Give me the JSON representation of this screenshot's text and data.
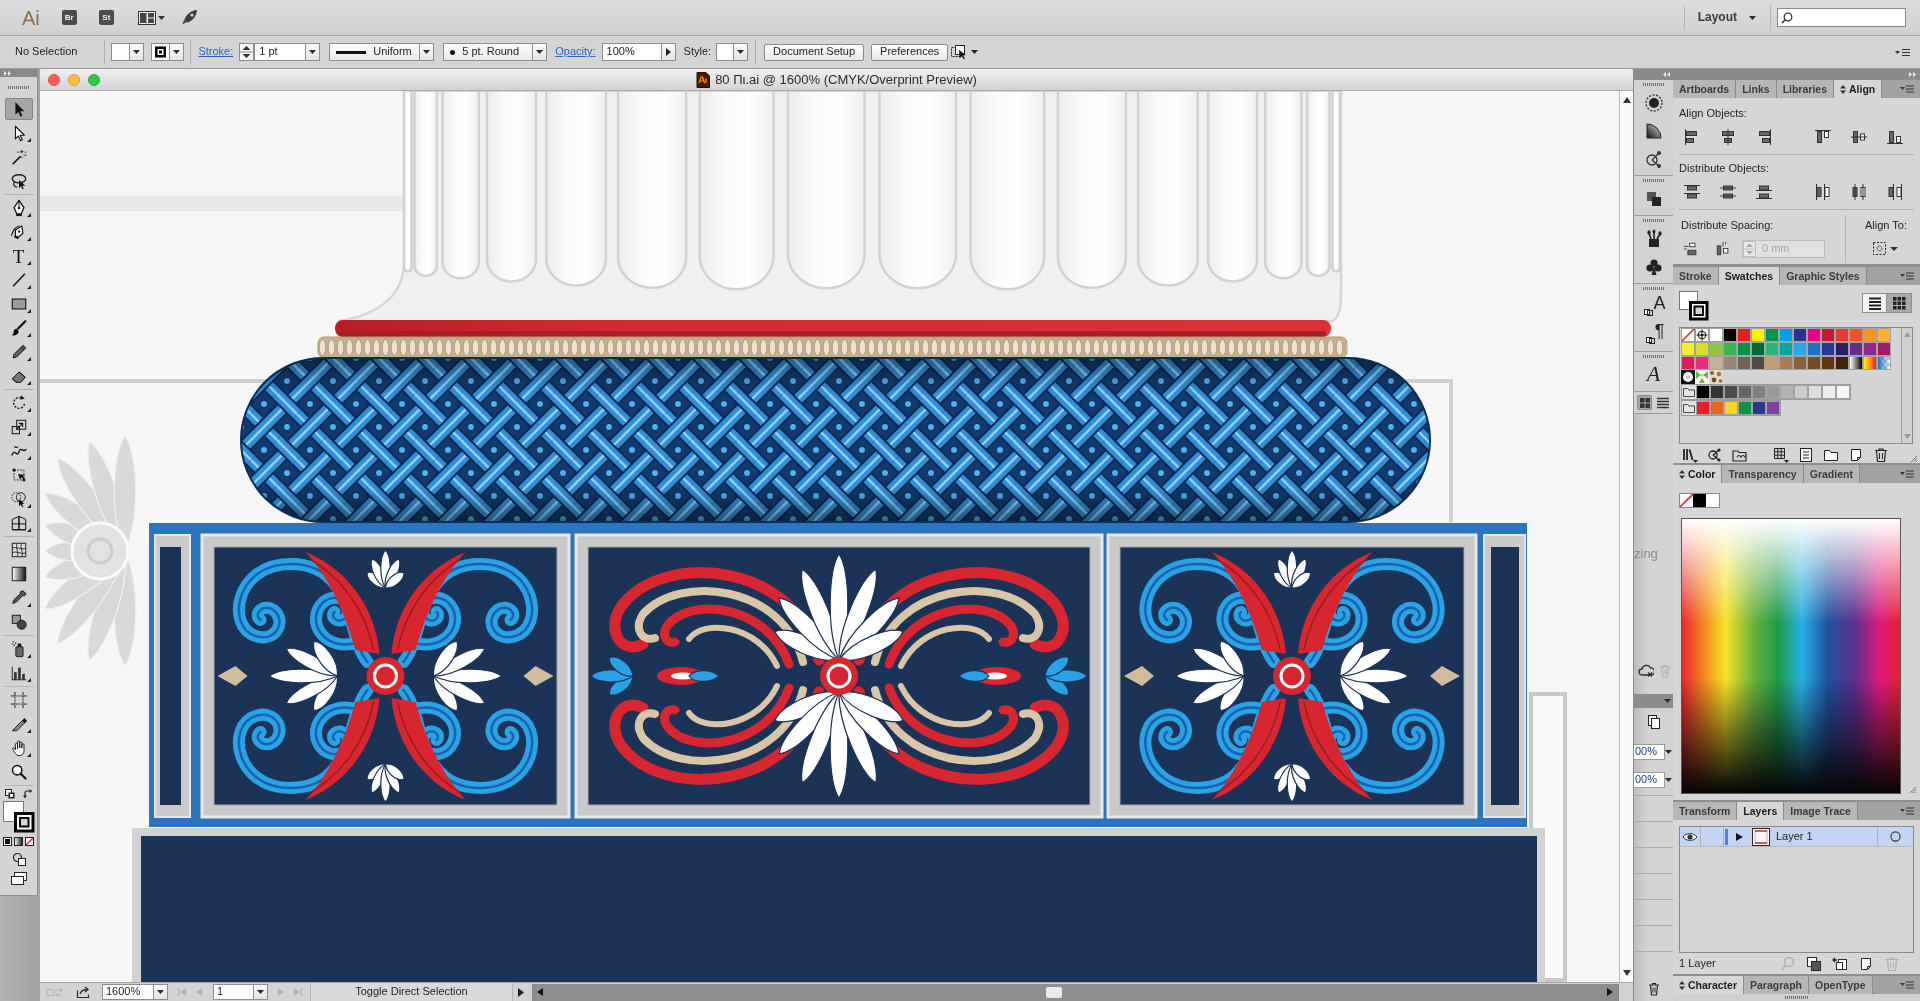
{
  "app_bar": {
    "logo": "Ai",
    "bridge": "Br",
    "stock": "St",
    "workspace": "Layout"
  },
  "control_bar": {
    "selection": "No Selection",
    "stroke_label": "Stroke:",
    "stroke_weight": "1 pt",
    "profile": "Uniform",
    "brush": "5 pt. Round",
    "opacity_label": "Opacity:",
    "opacity": "100%",
    "style_label": "Style:",
    "buttons": [
      "Document Setup",
      "Preferences"
    ]
  },
  "tool_groups": [
    [
      {
        "kind": "selection",
        "selected": true,
        "flyout": false
      },
      {
        "kind": "direct-selection",
        "selected": false,
        "flyout": true
      },
      {
        "kind": "magic-wand",
        "selected": false,
        "flyout": false
      },
      {
        "kind": "lasso",
        "selected": false,
        "flyout": false
      }
    ],
    [
      {
        "kind": "pen",
        "selected": false,
        "flyout": true
      },
      {
        "kind": "curvature",
        "selected": false,
        "flyout": true
      },
      {
        "kind": "type",
        "glyph": "T",
        "selected": false,
        "flyout": true
      },
      {
        "kind": "line",
        "selected": false,
        "flyout": true
      },
      {
        "kind": "rectangle",
        "selected": false,
        "flyout": true
      },
      {
        "kind": "paintbrush",
        "selected": false,
        "flyout": true
      },
      {
        "kind": "pencil",
        "selected": false,
        "flyout": true
      },
      {
        "kind": "eraser",
        "selected": false,
        "flyout": true
      }
    ],
    [
      {
        "kind": "rotate",
        "selected": false,
        "flyout": true
      },
      {
        "kind": "scale",
        "selected": false,
        "flyout": true
      },
      {
        "kind": "width",
        "selected": false,
        "flyout": true
      },
      {
        "kind": "free-transform",
        "selected": false,
        "flyout": false
      },
      {
        "kind": "shape-builder",
        "selected": false,
        "flyout": true
      },
      {
        "kind": "perspective",
        "selected": false,
        "flyout": true
      }
    ],
    [
      {
        "kind": "mesh",
        "selected": false,
        "flyout": false
      },
      {
        "kind": "gradient",
        "selected": false,
        "flyout": false
      },
      {
        "kind": "eyedropper",
        "selected": false,
        "flyout": true
      },
      {
        "kind": "blend",
        "selected": false,
        "flyout": false
      }
    ],
    [
      {
        "kind": "symbol-sprayer",
        "selected": false,
        "flyout": true
      },
      {
        "kind": "graph",
        "selected": false,
        "flyout": true
      }
    ],
    [
      {
        "kind": "artboard",
        "selected": false,
        "flyout": false
      },
      {
        "kind": "slice",
        "selected": false,
        "flyout": true
      },
      {
        "kind": "hand",
        "selected": false,
        "flyout": true
      },
      {
        "kind": "zoom",
        "selected": false,
        "flyout": false
      }
    ]
  ],
  "document": {
    "title": "80 Πι.ai @ 1600% (CMYK/Overprint Preview)"
  },
  "status_bar": {
    "buttons": [
      {
        "kind": "sync",
        "disabled": true
      },
      {
        "kind": "share",
        "disabled": false
      }
    ],
    "zoom": "1600%",
    "nav_before": [
      {
        "kind": "first",
        "disabled": true
      },
      {
        "kind": "previous",
        "disabled": true
      }
    ],
    "artboard": "1",
    "nav_after": [
      {
        "kind": "next",
        "disabled": true
      },
      {
        "kind": "last",
        "disabled": true
      }
    ],
    "message": "Toggle Direct Selection"
  },
  "dock": {
    "groups": [
      [
        {
          "kind": "appearance"
        },
        {
          "kind": "transparency"
        },
        {
          "kind": "links"
        }
      ],
      [
        {
          "kind": "pathfinder"
        }
      ],
      [
        {
          "kind": "brushes"
        },
        {
          "kind": "symbols"
        }
      ],
      [
        {
          "kind": "character-styles",
          "glyph": "A"
        },
        {
          "kind": "paragraph-styles",
          "glyph": "¶"
        }
      ],
      [
        {
          "kind": "glyphs",
          "glyph": "A"
        }
      ]
    ],
    "views": [
      {
        "kind": "grid",
        "selected": true
      },
      {
        "kind": "list",
        "selected": false
      }
    ]
  },
  "side_panel": {
    "text": "zing",
    "buttons": [
      {
        "kind": "cloud",
        "disabled": false
      },
      {
        "kind": "trash",
        "disabled": true
      }
    ],
    "fields": [
      "00%",
      "00%"
    ]
  },
  "align_panel": {
    "tabs": [
      {
        "label": "Artboards",
        "selected": false,
        "options_toggle": false
      },
      {
        "label": "Links",
        "selected": false,
        "options_toggle": false
      },
      {
        "label": "Libraries",
        "selected": false,
        "options_toggle": false
      },
      {
        "label": "Align",
        "selected": true,
        "options_toggle": true
      }
    ],
    "sections": [
      "Align Objects:",
      "Distribute Objects:",
      "Distribute Spacing:"
    ],
    "spacing": {
      "value": "0 mm",
      "disabled": true
    },
    "align_to": "Align To:"
  },
  "swatches_panel": {
    "tabs": [
      {
        "label": "Stroke",
        "selected": false,
        "options_toggle": false
      },
      {
        "label": "Swatches",
        "selected": true,
        "options_toggle": false
      },
      {
        "label": "Graphic Styles",
        "selected": false,
        "options_toggle": false
      }
    ],
    "views": [
      {
        "kind": "list",
        "selected": false
      },
      {
        "kind": "grid",
        "selected": true
      }
    ],
    "rows": [
      [
        {
          "kind": "none"
        },
        {
          "kind": "registration"
        },
        {
          "kind": "color",
          "color": "#ffffff"
        },
        {
          "kind": "color",
          "color": "#000000"
        },
        {
          "kind": "color",
          "color": "#e41e26"
        },
        {
          "kind": "color",
          "color": "#fff100"
        },
        {
          "kind": "color",
          "color": "#00964b"
        },
        {
          "kind": "color",
          "color": "#00a0e3"
        },
        {
          "kind": "color",
          "color": "#2e3191"
        },
        {
          "kind": "color",
          "color": "#e5008b"
        },
        {
          "kind": "color",
          "color": "#be1e2d"
        },
        {
          "kind": "color",
          "color": "#e33b32"
        },
        {
          "kind": "color",
          "color": "#eb5628"
        },
        {
          "kind": "color",
          "color": "#f7941d"
        },
        {
          "kind": "color",
          "color": "#fbb040"
        }
      ],
      [
        {
          "kind": "color",
          "color": "#f9ed32"
        },
        {
          "kind": "color",
          "color": "#d7df23"
        },
        {
          "kind": "color",
          "color": "#8dc63f"
        },
        {
          "kind": "color",
          "color": "#39b54a"
        },
        {
          "kind": "color",
          "color": "#009444"
        },
        {
          "kind": "color",
          "color": "#006838"
        },
        {
          "kind": "color",
          "color": "#2bb673"
        },
        {
          "kind": "color",
          "color": "#00a79d"
        },
        {
          "kind": "color",
          "color": "#27aae1"
        },
        {
          "kind": "color",
          "color": "#1c75bc"
        },
        {
          "kind": "color",
          "color": "#2b3990"
        },
        {
          "kind": "color",
          "color": "#262262"
        },
        {
          "kind": "color",
          "color": "#662d91"
        },
        {
          "kind": "color",
          "color": "#92278f"
        },
        {
          "kind": "color",
          "color": "#9e1f63"
        }
      ],
      [
        {
          "kind": "color",
          "color": "#da1c5c"
        },
        {
          "kind": "color",
          "color": "#ee2a7b"
        },
        {
          "kind": "color",
          "color": "#c7b299"
        },
        {
          "kind": "color",
          "color": "#998675"
        },
        {
          "kind": "color",
          "color": "#736357"
        },
        {
          "kind": "color",
          "color": "#534741"
        },
        {
          "kind": "color",
          "color": "#c69c6d"
        },
        {
          "kind": "color",
          "color": "#a67c52"
        },
        {
          "kind": "color",
          "color": "#8c6239"
        },
        {
          "kind": "color",
          "color": "#754c24"
        },
        {
          "kind": "color",
          "color": "#603913"
        },
        {
          "kind": "color",
          "color": "#42210b"
        },
        {
          "kind": "gradient-black-white"
        },
        {
          "kind": "gradient-yellow-red"
        },
        {
          "kind": "gradient-fade-blue"
        }
      ],
      [
        {
          "kind": "pattern-dots"
        },
        {
          "kind": "pattern-leaves"
        },
        {
          "kind": "pattern-pebbles"
        }
      ]
    ],
    "groups": [
      [
        {
          "kind": "folder"
        },
        {
          "kind": "color",
          "color": "#000000"
        },
        {
          "kind": "color",
          "color": "#333333"
        },
        {
          "kind": "color",
          "color": "#4d4d4d"
        },
        {
          "kind": "color",
          "color": "#666666"
        },
        {
          "kind": "color",
          "color": "#808080"
        },
        {
          "kind": "color",
          "color": "#999999"
        },
        {
          "kind": "color",
          "color": "#b3b3b3"
        },
        {
          "kind": "color",
          "color": "#cccccc"
        },
        {
          "kind": "color",
          "color": "#dddddd"
        },
        {
          "kind": "color",
          "color": "#eeeeee"
        },
        {
          "kind": "color",
          "color": "#f7f7f7"
        }
      ],
      [
        {
          "kind": "folder"
        },
        {
          "kind": "color",
          "color": "#e61e2a"
        },
        {
          "kind": "color",
          "color": "#ec6422"
        },
        {
          "kind": "color",
          "color": "#fcd424"
        },
        {
          "kind": "color",
          "color": "#0b9447"
        },
        {
          "kind": "color",
          "color": "#2a3990"
        },
        {
          "kind": "color",
          "color": "#7f3f98"
        }
      ]
    ]
  },
  "color_panel": {
    "tabs": [
      {
        "label": "Color",
        "selected": true,
        "options_toggle": true
      },
      {
        "label": "Transparency",
        "selected": false,
        "options_toggle": false
      },
      {
        "label": "Gradient",
        "selected": false,
        "options_toggle": false
      }
    ],
    "quick_swatches": [
      {
        "kind": "none"
      },
      {
        "kind": "color",
        "color": "#000000"
      },
      {
        "kind": "color",
        "color": "#ffffff"
      }
    ]
  },
  "layers_panel": {
    "tabs": [
      {
        "label": "Transform",
        "selected": false,
        "options_toggle": false
      },
      {
        "label": "Layers",
        "selected": true,
        "options_toggle": false
      },
      {
        "label": "Image Trace",
        "selected": false,
        "options_toggle": false
      }
    ],
    "layers": [
      {
        "name": "Layer 1",
        "visible": true,
        "locked": false,
        "expanded": false,
        "selected": true,
        "color": "#4f7df0"
      }
    ],
    "count": "1 Layer",
    "buttons": [
      {
        "kind": "search",
        "disabled": true
      },
      {
        "kind": "clipping-mask",
        "disabled": false
      },
      {
        "kind": "new-sublayer",
        "disabled": false
      },
      {
        "kind": "new-layer",
        "disabled": false
      },
      {
        "kind": "trash",
        "disabled": true
      }
    ]
  },
  "character_panel": {
    "tabs": [
      {
        "label": "Character",
        "selected": true,
        "options_toggle": true
      },
      {
        "label": "Paragraph",
        "selected": false,
        "options_toggle": false
      },
      {
        "label": "OpenType",
        "selected": false,
        "options_toggle": false
      }
    ]
  }
}
